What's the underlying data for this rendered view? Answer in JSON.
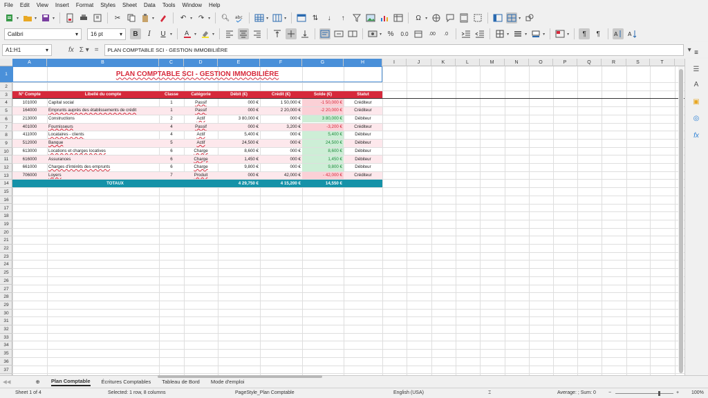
{
  "menu": [
    "File",
    "Edit",
    "View",
    "Insert",
    "Format",
    "Styles",
    "Sheet",
    "Data",
    "Tools",
    "Window",
    "Help"
  ],
  "toolbar": {
    "font_name": "Calibri",
    "font_size": "16 pt"
  },
  "formula_bar": {
    "name_box": "A1:H1",
    "content": "PLAN COMPTABLE SCI - GESTION IMMOBILIÈRE"
  },
  "columns": [
    "A",
    "B",
    "C",
    "D",
    "E",
    "F",
    "G",
    "H",
    "I",
    "J",
    "K",
    "L",
    "M",
    "N",
    "O",
    "P",
    "Q",
    "R",
    "S",
    "T"
  ],
  "sheet": {
    "title": "PLAN COMPTABLE SCI - GESTION IMMOBILIÈRE",
    "headers": [
      "N° Compte",
      "Libellé du compte",
      "Classe",
      "Catégorie",
      "Débit (€)",
      "Crédit (€)",
      "Solde (€)",
      "Statut"
    ],
    "rows": [
      {
        "compte": "101000",
        "libelle": "Capital social",
        "classe": "1",
        "categorie": "Passif",
        "debit": "000 €",
        "credit": "1 50,000 €",
        "solde": "-1 50,000 €",
        "statut": "Créditeur"
      },
      {
        "compte": "164000",
        "libelle": "Emprunts auprès des établissements de crédit",
        "classe": "1",
        "categorie": "Passif",
        "debit": "000 €",
        "credit": "2 20,000 €",
        "solde": "-2 20,000 €",
        "statut": "Créditeur"
      },
      {
        "compte": "213000",
        "libelle": "Constructions",
        "classe": "2",
        "categorie": "Actif",
        "debit": "3 80,000 €",
        "credit": "000 €",
        "solde": "3 80,000 €",
        "statut": "Débiteur"
      },
      {
        "compte": "401000",
        "libelle": "Fournisseurs",
        "classe": "4",
        "categorie": "Passif",
        "debit": "000 €",
        "credit": "3,200 €",
        "solde": "-3,200 €",
        "statut": "Créditeur"
      },
      {
        "compte": "411000",
        "libelle": "Locataires - clients",
        "classe": "4",
        "categorie": "Actif",
        "debit": "5,400 €",
        "credit": "000 €",
        "solde": "5,400 €",
        "statut": "Débiteur"
      },
      {
        "compte": "512000",
        "libelle": "Banque",
        "classe": "5",
        "categorie": "Actif",
        "debit": "24,500 €",
        "credit": "000 €",
        "solde": "24,500 €",
        "statut": "Débiteur"
      },
      {
        "compte": "613000",
        "libelle": "Locations et charges locatives",
        "classe": "6",
        "categorie": "Charge",
        "debit": "8,600 €",
        "credit": "000 €",
        "solde": "8,600 €",
        "statut": "Débiteur"
      },
      {
        "compte": "616000",
        "libelle": "Assurances",
        "classe": "6",
        "categorie": "Charge",
        "debit": "1,450 €",
        "credit": "000 €",
        "solde": "1,450 €",
        "statut": "Débiteur"
      },
      {
        "compte": "661000",
        "libelle": "Charges d'intérêts des emprunts",
        "classe": "6",
        "categorie": "Charge",
        "debit": "9,800 €",
        "credit": "000 €",
        "solde": "9,800 €",
        "statut": "Débiteur"
      },
      {
        "compte": "706000",
        "libelle": "Loyers",
        "classe": "7",
        "categorie": "Produit",
        "debit": "000 €",
        "credit": "42,000 €",
        "solde": "- 42,000 €",
        "statut": "Créditeur"
      }
    ],
    "totals": {
      "label": "TOTAUX",
      "debit": "4 29,750 €",
      "credit": "4 15,200 €",
      "solde": "14,550 €"
    }
  },
  "tabs": [
    "Plan Comptable",
    "Écritures Comptables",
    "Tableau de Bord",
    "Mode d'emploi"
  ],
  "status": {
    "sheet": "Sheet 1 of 4",
    "selection": "Selected: 1 row, 8 columns",
    "page_style": "PageStyle_Plan Comptable",
    "language": "English (USA)",
    "summary": "Average: ; Sum: 0",
    "zoom": "100%"
  }
}
